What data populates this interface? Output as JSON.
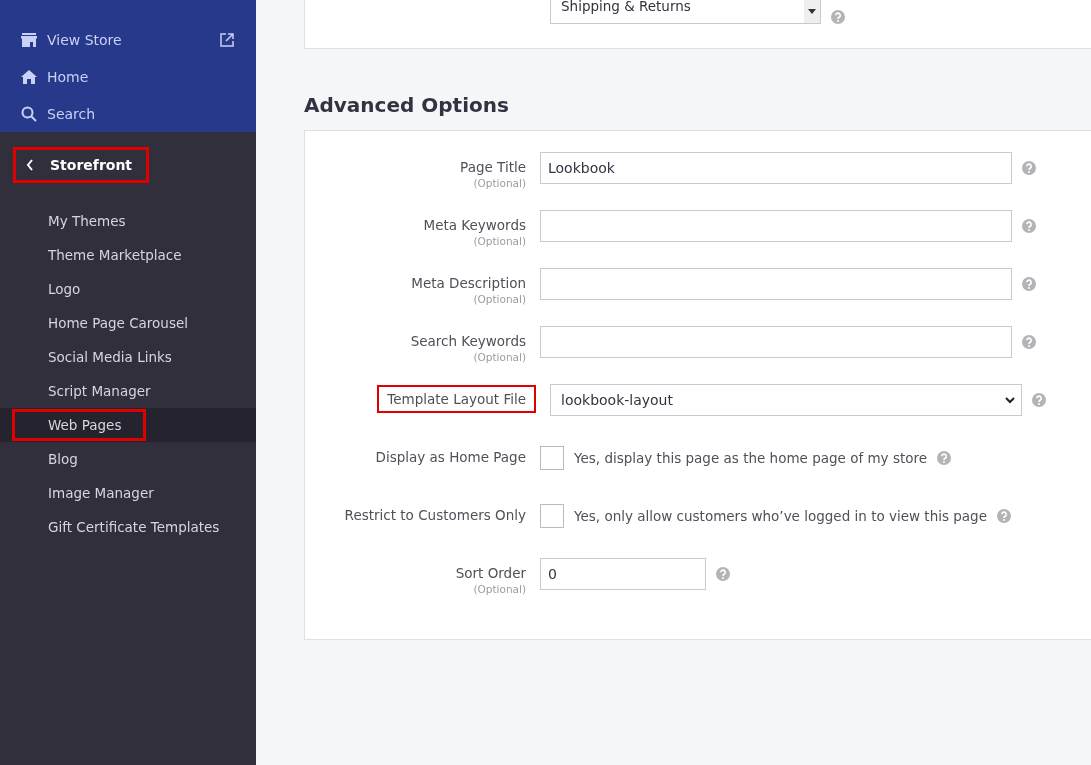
{
  "sidebar": {
    "top_items": [
      {
        "label": "View Store",
        "external": true
      },
      {
        "label": "Home",
        "external": false
      },
      {
        "label": "Search",
        "external": false
      }
    ],
    "section": {
      "label": "Storefront",
      "highlighted": true
    },
    "items": [
      {
        "label": "My Themes",
        "selected": false,
        "highlighted": false
      },
      {
        "label": "Theme Marketplace",
        "selected": false,
        "highlighted": false
      },
      {
        "label": "Logo",
        "selected": false,
        "highlighted": false
      },
      {
        "label": "Home Page Carousel",
        "selected": false,
        "highlighted": false
      },
      {
        "label": "Social Media Links",
        "selected": false,
        "highlighted": false
      },
      {
        "label": "Script Manager",
        "selected": false,
        "highlighted": false
      },
      {
        "label": "Web Pages",
        "selected": true,
        "highlighted": true
      },
      {
        "label": "Blog",
        "selected": false,
        "highlighted": false
      },
      {
        "label": "Image Manager",
        "selected": false,
        "highlighted": false
      },
      {
        "label": "Gift Certificate Templates",
        "selected": false,
        "highlighted": false
      }
    ]
  },
  "top_list": {
    "options": [
      "Shipping & Returns"
    ]
  },
  "advanced": {
    "title": "Advanced Options",
    "fields": [
      {
        "kind": "text",
        "label": "Page Title",
        "hint": "(Optional)",
        "value": "Lookbook",
        "highlighted": false
      },
      {
        "kind": "text",
        "label": "Meta Keywords",
        "hint": "(Optional)",
        "highlighted": false
      },
      {
        "kind": "text",
        "label": "Meta Description",
        "hint": "(Optional)",
        "highlighted": false
      },
      {
        "kind": "text",
        "label": "Search Keywords",
        "hint": "(Optional)",
        "highlighted": false
      },
      {
        "kind": "select",
        "label": "Template Layout File",
        "value": "lookbook-layout",
        "highlighted": true
      },
      {
        "kind": "checkbox",
        "label": "Display as Home Page",
        "text": "Yes, display this page as the home page of my store",
        "checked": false,
        "highlighted": false
      },
      {
        "kind": "checkbox",
        "label": "Restrict to Customers Only",
        "text": "Yes, only allow customers who’ve logged in to view this page",
        "checked": false,
        "highlighted": false
      },
      {
        "kind": "short",
        "label": "Sort Order",
        "hint": "(Optional)",
        "value": "0",
        "highlighted": false
      }
    ]
  }
}
